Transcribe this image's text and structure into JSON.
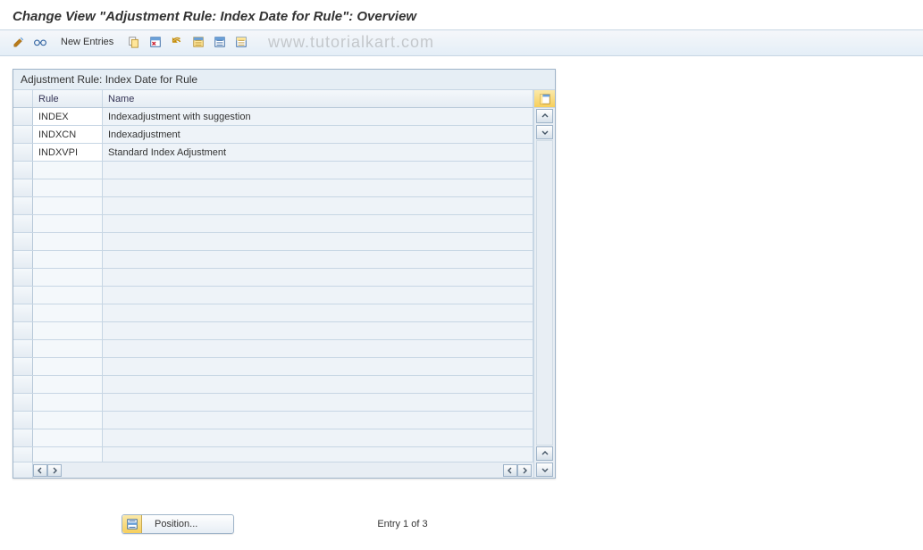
{
  "title": "Change View \"Adjustment Rule: Index Date for Rule\": Overview",
  "toolbar": {
    "new_entries_label": "New Entries"
  },
  "watermark": "www.tutorialkart.com",
  "panel": {
    "title": "Adjustment Rule: Index Date for Rule",
    "columns": {
      "rule": "Rule",
      "name": "Name"
    },
    "rows": [
      {
        "rule": "INDEX",
        "name": "Indexadjustment with suggestion"
      },
      {
        "rule": "INDXCN",
        "name": "Indexadjustment"
      },
      {
        "rule": "INDXVPI",
        "name": "Standard Index Adjustment"
      }
    ],
    "empty_row_count": 17
  },
  "footer": {
    "position_label": "Position...",
    "entry_text": "Entry 1 of 3"
  },
  "icons": {
    "toggle": "toggle-icon",
    "glasses": "glasses-icon",
    "copy": "copy-icon",
    "save": "save-icon",
    "undo": "undo-icon",
    "select_all": "select-all-icon",
    "deselect_all": "deselect-all-icon",
    "export": "export-icon",
    "config": "config-icon",
    "position": "position-icon"
  }
}
